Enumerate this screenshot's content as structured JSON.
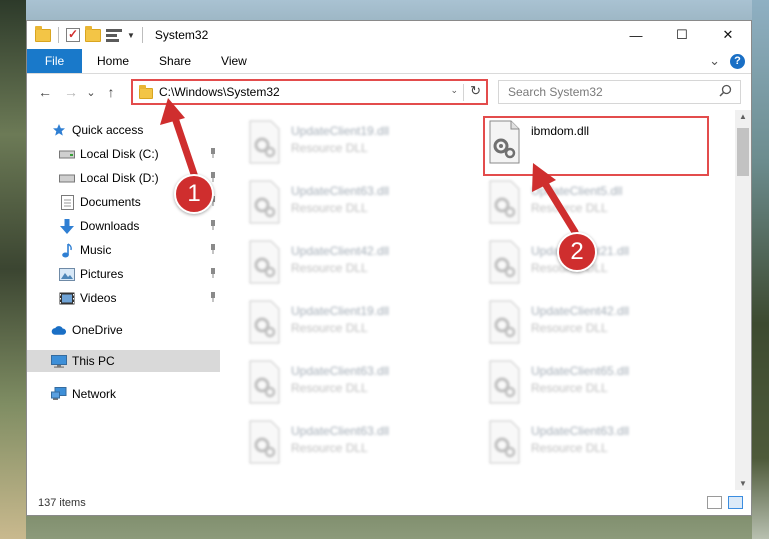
{
  "window": {
    "title": "System32",
    "min_glyph": "—",
    "max_glyph": "☐",
    "close_glyph": "✕"
  },
  "ribbon": {
    "tabs": [
      "File",
      "Home",
      "Share",
      "View"
    ],
    "expand_glyph": "⌄",
    "help_glyph": "?"
  },
  "nav": {
    "back_glyph": "←",
    "forward_glyph": "→",
    "recent_glyph": "⌄",
    "up_glyph": "↑",
    "address": "C:\\Windows\\System32",
    "dropdown_glyph": "⌄",
    "refresh_glyph": "↻",
    "search_placeholder": "Search System32"
  },
  "sidebar": {
    "items": [
      {
        "label": "Quick access",
        "icon": "star-icon"
      },
      {
        "label": "Local Disk (C:)",
        "icon": "drive-icon"
      },
      {
        "label": "Local Disk (D:)",
        "icon": "drive-icon"
      },
      {
        "label": "Documents",
        "icon": "documents-icon"
      },
      {
        "label": "Downloads",
        "icon": "download-icon"
      },
      {
        "label": "Music",
        "icon": "music-icon"
      },
      {
        "label": "Pictures",
        "icon": "pictures-icon"
      },
      {
        "label": "Videos",
        "icon": "videos-icon"
      },
      {
        "label": "OneDrive",
        "icon": "cloud-icon"
      },
      {
        "label": "This PC",
        "icon": "computer-icon"
      },
      {
        "label": "Network",
        "icon": "network-icon"
      }
    ]
  },
  "files": {
    "left": [
      {
        "name": "UpdateClient19.dll",
        "type": "Resource DLL"
      },
      {
        "name": "UpdateClient63.dll",
        "type": "Resource DLL"
      },
      {
        "name": "UpdateClient42.dll",
        "type": "Resource DLL"
      },
      {
        "name": "UpdateClient19.dll",
        "type": "Resource DLL"
      },
      {
        "name": "UpdateClient63.dll",
        "type": "Resource DLL"
      },
      {
        "name": "UpdateClient63.dll",
        "type": "Resource DLL"
      }
    ],
    "right": [
      {
        "name": "ibmdom.dll",
        "type": ""
      },
      {
        "name": "UpdateClient5.dll",
        "type": "Resource DLL"
      },
      {
        "name": "UpdateClient21.dll",
        "type": "Resource DLL"
      },
      {
        "name": "UpdateClient42.dll",
        "type": "Resource DLL"
      },
      {
        "name": "UpdateClient65.dll",
        "type": "Resource DLL"
      },
      {
        "name": "UpdateClient63.dll",
        "type": "Resource DLL"
      }
    ]
  },
  "status": {
    "item_count": "137 items"
  },
  "annotations": {
    "badge1": "1",
    "badge2": "2",
    "color": "#cf2e2e"
  },
  "colors": {
    "file_tab": "#1979ca",
    "highlight": "#e34c4c"
  }
}
